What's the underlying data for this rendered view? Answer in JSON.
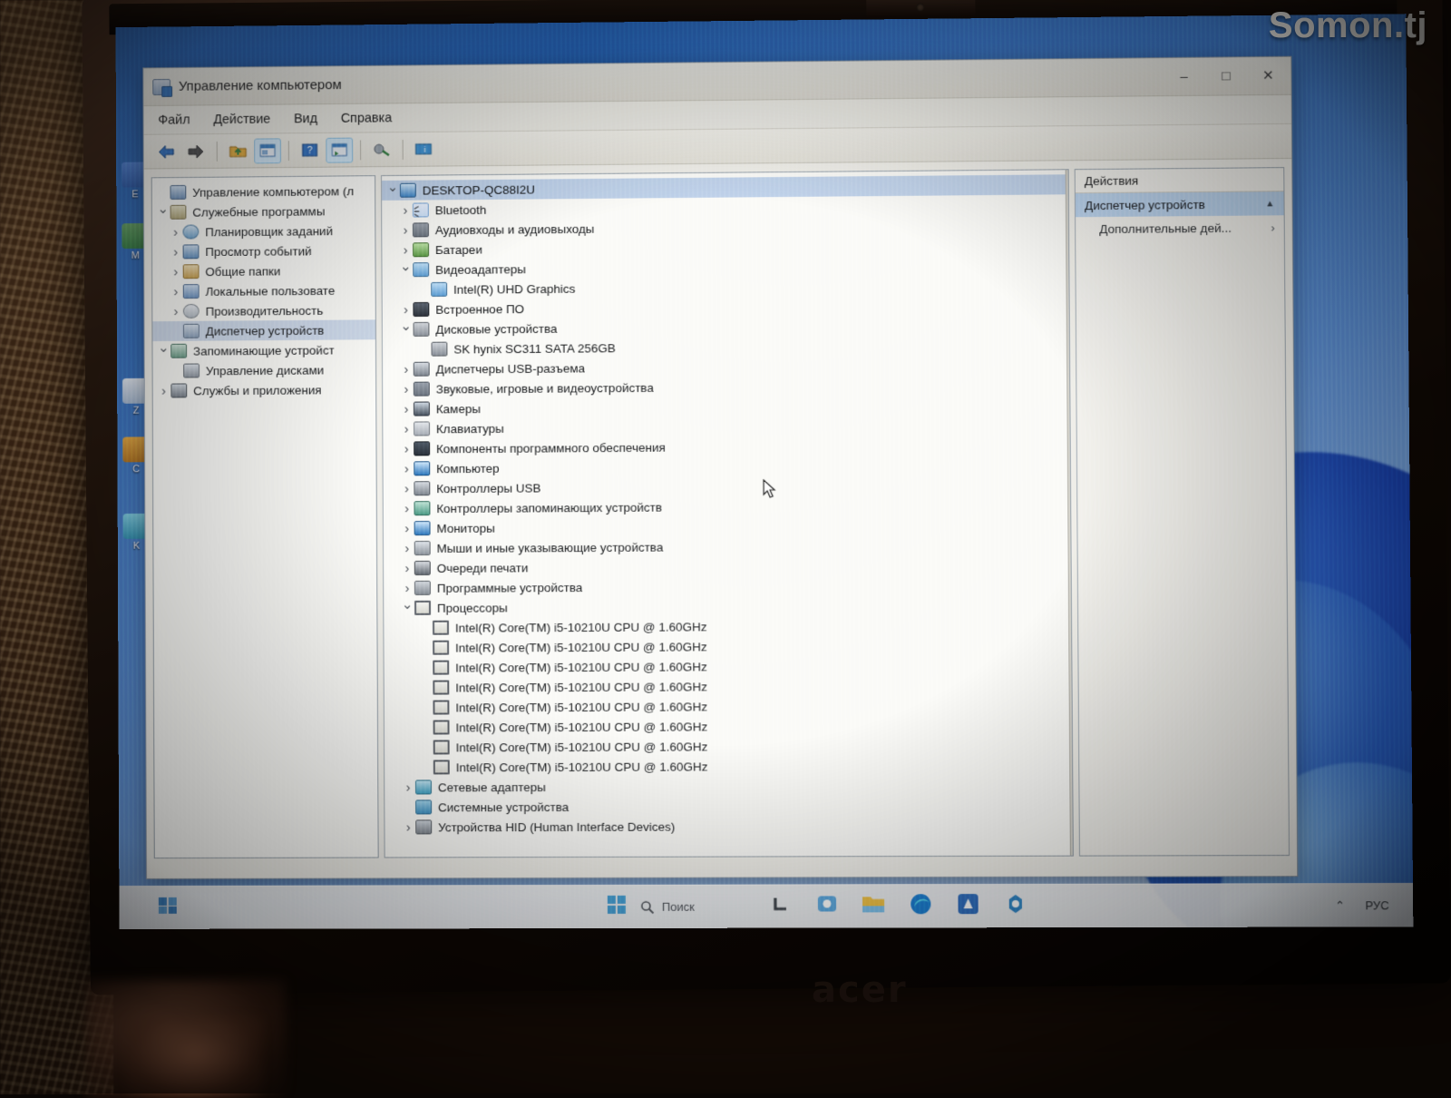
{
  "watermark": "Somon.tj",
  "laptop_brand": "acer",
  "window": {
    "title": "Управление компьютером",
    "menu": [
      "Файл",
      "Действие",
      "Вид",
      "Справка"
    ],
    "controls": {
      "minimize": "–",
      "maximize": "□",
      "close": "✕"
    },
    "toolbar_icons": [
      "back-arrow",
      "forward-arrow",
      "up-folder",
      "properties",
      "help",
      "show-hide-console-tree",
      "scan-for-hardware-changes",
      "help-info"
    ]
  },
  "left_tree": [
    {
      "label": "Управление компьютером (л",
      "indent": 0,
      "chev": "none",
      "icon": "i-root",
      "selected": false
    },
    {
      "label": "Служебные программы",
      "indent": 0,
      "chev": "down",
      "icon": "i-tool",
      "selected": false
    },
    {
      "label": "Планировщик заданий",
      "indent": 1,
      "chev": "right",
      "icon": "i-task",
      "selected": false
    },
    {
      "label": "Просмотр событий",
      "indent": 1,
      "chev": "right",
      "icon": "i-evt",
      "selected": false
    },
    {
      "label": "Общие папки",
      "indent": 1,
      "chev": "right",
      "icon": "i-shr",
      "selected": false
    },
    {
      "label": "Локальные пользовате",
      "indent": 1,
      "chev": "right",
      "icon": "i-usr",
      "selected": false
    },
    {
      "label": "Производительность",
      "indent": 1,
      "chev": "right",
      "icon": "i-perf",
      "selected": false
    },
    {
      "label": "Диспетчер устройств",
      "indent": 1,
      "chev": "none",
      "icon": "i-dev",
      "selected": true
    },
    {
      "label": "Запоминающие устройст",
      "indent": 0,
      "chev": "down",
      "icon": "i-sto",
      "selected": false
    },
    {
      "label": "Управление дисками",
      "indent": 1,
      "chev": "none",
      "icon": "i-dm",
      "selected": false
    },
    {
      "label": "Службы и приложения",
      "indent": 0,
      "chev": "right",
      "icon": "i-svc",
      "selected": false
    }
  ],
  "device_tree": [
    {
      "label": "DESKTOP-QC88I2U",
      "indent": 0,
      "chev": "down",
      "icon": "i-pc",
      "selected": true
    },
    {
      "label": "Bluetooth",
      "indent": 1,
      "chev": "right",
      "icon": "i-bt",
      "selected": false
    },
    {
      "label": "Аудиовходы и аудиовыходы",
      "indent": 1,
      "chev": "right",
      "icon": "i-aud",
      "selected": false
    },
    {
      "label": "Батареи",
      "indent": 1,
      "chev": "right",
      "icon": "i-bat",
      "selected": false
    },
    {
      "label": "Видеоадаптеры",
      "indent": 1,
      "chev": "down",
      "icon": "i-vid",
      "selected": false
    },
    {
      "label": "Intel(R) UHD Graphics",
      "indent": 2,
      "chev": "none",
      "icon": "i-vid",
      "selected": false
    },
    {
      "label": "Встроенное ПО",
      "indent": 1,
      "chev": "right",
      "icon": "i-fw",
      "selected": false
    },
    {
      "label": "Дисковые устройства",
      "indent": 1,
      "chev": "down",
      "icon": "i-dsk",
      "selected": false
    },
    {
      "label": "SK hynix SC311 SATA 256GB",
      "indent": 2,
      "chev": "none",
      "icon": "i-dsk",
      "selected": false
    },
    {
      "label": "Диспетчеры USB-разъема",
      "indent": 1,
      "chev": "right",
      "icon": "i-usb",
      "selected": false
    },
    {
      "label": "Звуковые, игровые и видеоустройства",
      "indent": 1,
      "chev": "right",
      "icon": "i-aud",
      "selected": false
    },
    {
      "label": "Камеры",
      "indent": 1,
      "chev": "right",
      "icon": "i-cam",
      "selected": false
    },
    {
      "label": "Клавиатуры",
      "indent": 1,
      "chev": "right",
      "icon": "i-kbd",
      "selected": false
    },
    {
      "label": "Компоненты программного обеспечения",
      "indent": 1,
      "chev": "right",
      "icon": "i-soft",
      "selected": false
    },
    {
      "label": "Компьютер",
      "indent": 1,
      "chev": "right",
      "icon": "i-mon",
      "selected": false
    },
    {
      "label": "Контроллеры USB",
      "indent": 1,
      "chev": "right",
      "icon": "i-usb",
      "selected": false
    },
    {
      "label": "Контроллеры запоминающих устройств",
      "indent": 1,
      "chev": "right",
      "icon": "i-stc",
      "selected": false
    },
    {
      "label": "Мониторы",
      "indent": 1,
      "chev": "right",
      "icon": "i-mon",
      "selected": false
    },
    {
      "label": "Мыши и иные указывающие устройства",
      "indent": 1,
      "chev": "right",
      "icon": "i-mou",
      "selected": false
    },
    {
      "label": "Очереди печати",
      "indent": 1,
      "chev": "right",
      "icon": "i-prn",
      "selected": false
    },
    {
      "label": "Программные устройства",
      "indent": 1,
      "chev": "right",
      "icon": "i-sd",
      "selected": false
    },
    {
      "label": "Процессоры",
      "indent": 1,
      "chev": "down",
      "icon": "i-cpu",
      "selected": false
    },
    {
      "label": "Intel(R) Core(TM) i5-10210U CPU @ 1.60GHz",
      "indent": 2,
      "chev": "none",
      "icon": "i-cpu",
      "selected": false
    },
    {
      "label": "Intel(R) Core(TM) i5-10210U CPU @ 1.60GHz",
      "indent": 2,
      "chev": "none",
      "icon": "i-cpu",
      "selected": false
    },
    {
      "label": "Intel(R) Core(TM) i5-10210U CPU @ 1.60GHz",
      "indent": 2,
      "chev": "none",
      "icon": "i-cpu",
      "selected": false
    },
    {
      "label": "Intel(R) Core(TM) i5-10210U CPU @ 1.60GHz",
      "indent": 2,
      "chev": "none",
      "icon": "i-cpu",
      "selected": false
    },
    {
      "label": "Intel(R) Core(TM) i5-10210U CPU @ 1.60GHz",
      "indent": 2,
      "chev": "none",
      "icon": "i-cpu",
      "selected": false
    },
    {
      "label": "Intel(R) Core(TM) i5-10210U CPU @ 1.60GHz",
      "indent": 2,
      "chev": "none",
      "icon": "i-cpu",
      "selected": false
    },
    {
      "label": "Intel(R) Core(TM) i5-10210U CPU @ 1.60GHz",
      "indent": 2,
      "chev": "none",
      "icon": "i-cpu",
      "selected": false
    },
    {
      "label": "Intel(R) Core(TM) i5-10210U CPU @ 1.60GHz",
      "indent": 2,
      "chev": "none",
      "icon": "i-cpu",
      "selected": false
    },
    {
      "label": "Сетевые адаптеры",
      "indent": 1,
      "chev": "right",
      "icon": "i-net",
      "selected": false
    },
    {
      "label": "Системные устройства",
      "indent": 1,
      "chev": "none",
      "icon": "i-sys",
      "selected": false
    },
    {
      "label": "Устройства HID (Human Interface Devices)",
      "indent": 1,
      "chev": "right",
      "icon": "i-hid",
      "selected": false
    }
  ],
  "actions_pane": {
    "header": "Действия",
    "selected": "Диспетчер устройств",
    "items": [
      "Дополнительные дей..."
    ]
  },
  "taskbar": {
    "search_placeholder": "Поиск",
    "tray_chevron": "⌃",
    "language": "РУС",
    "apps": [
      "start-button",
      "search-icon",
      "task-view-icon",
      "widgets-icon",
      "file-explorer-icon",
      "edge-icon",
      "store-icon",
      "settings-icon"
    ]
  },
  "desktop_icons": [
    "E",
    "M",
    "Z",
    "C",
    "K"
  ]
}
